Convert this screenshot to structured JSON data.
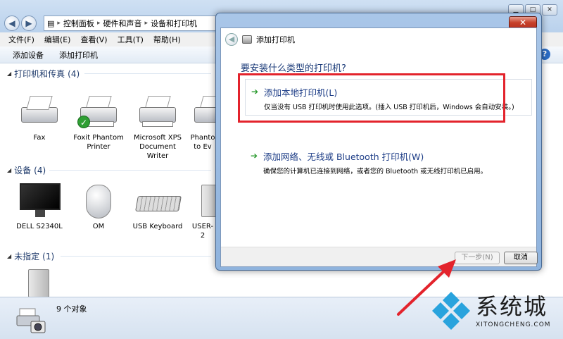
{
  "explorer": {
    "address": [
      "控制面板",
      "硬件和声音",
      "设备和打印机"
    ],
    "menu": [
      "文件(F)",
      "编辑(E)",
      "查看(V)",
      "工具(T)",
      "帮助(H)"
    ],
    "toolbar": [
      "添加设备",
      "添加打印机"
    ],
    "groups": {
      "printers": {
        "label": "打印机和传真",
        "count": "(4)"
      },
      "devices": {
        "label": "设备",
        "count": "(4)"
      },
      "unspecified": {
        "label": "未指定",
        "count": "(1)"
      }
    },
    "printers": [
      "Fax",
      "Foxit Phantom Printer",
      "Microsoft XPS Document Writer",
      "Phanto to Ev"
    ],
    "devices": [
      "DELL S2340L",
      "OM",
      "USB Keyboard",
      "USER-2"
    ],
    "status_text": "9 个对象"
  },
  "dialog": {
    "title": "添加打印机",
    "close_glyph": "✕",
    "question": "要安装什么类型的打印机?",
    "option_local": {
      "title": "添加本地打印机(L)",
      "desc": "仅当没有 USB 打印机时使用此选项。(插入 USB 打印机后，Windows 会自动安装。)"
    },
    "option_network": {
      "title": "添加网络、无线或 Bluetooth 打印机(W)",
      "desc": "确保您的计算机已连接到网络，或者您的 Bluetooth 或无线打印机已启用。"
    },
    "next_label": "下一步(N)",
    "cancel_label": "取消"
  },
  "watermark": {
    "text": "系统城",
    "sub": "XITONGCHENG.COM"
  },
  "colors": {
    "highlight": "#e3232c",
    "link_blue": "#1c3c86",
    "arrow_green": "#2b9a2f"
  }
}
